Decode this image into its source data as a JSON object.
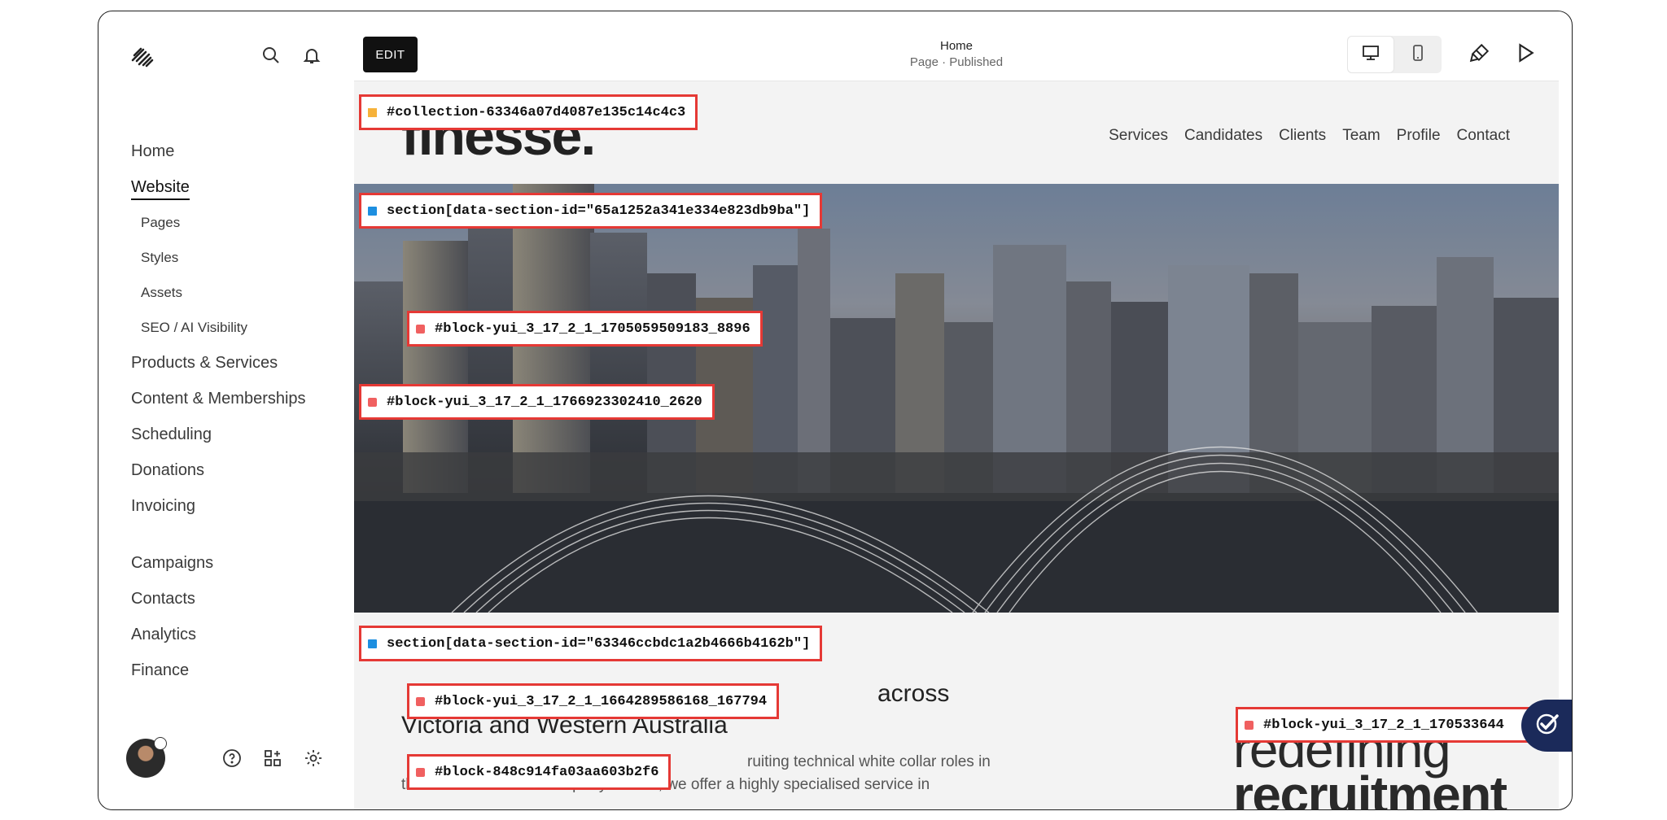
{
  "sidebar": {
    "nav": [
      {
        "label": "Home"
      },
      {
        "label": "Website",
        "active": true
      },
      {
        "label": "Pages",
        "sub": true
      },
      {
        "label": "Styles",
        "sub": true
      },
      {
        "label": "Assets",
        "sub": true
      },
      {
        "label": "SEO / AI Visibility",
        "sub": true
      },
      {
        "label": "Products & Services"
      },
      {
        "label": "Content & Memberships"
      },
      {
        "label": "Scheduling"
      },
      {
        "label": "Donations"
      },
      {
        "label": "Invoicing"
      },
      {
        "label": "Campaigns"
      },
      {
        "label": "Contacts"
      },
      {
        "label": "Analytics"
      },
      {
        "label": "Finance"
      }
    ],
    "icons": {
      "logo": "squarespace-logo-icon",
      "search": "search-icon",
      "notifications": "bell-icon",
      "help": "help-icon",
      "apps": "apps-icon",
      "settings": "gear-icon"
    }
  },
  "editor": {
    "edit_label": "EDIT",
    "page_title": "Home",
    "page_status": "Page · Published",
    "icons": {
      "desktop": "desktop-icon",
      "mobile": "mobile-icon",
      "design": "paintbrush-icon",
      "preview": "play-icon"
    }
  },
  "site": {
    "logo": "finesse.",
    "nav": [
      "Services",
      "Candidates",
      "Clients",
      "Team",
      "Profile",
      "Contact"
    ],
    "heading_line1": "across",
    "heading_line2": "Victoria and Western Australia",
    "body_line1": "ruiting technical white collar roles in",
    "body_line2": "the Construction and Property Market, we offer a highly specialised service in",
    "tagline_line1": "redefining",
    "tagline_line2": "recruitment"
  },
  "selectors": {
    "collection": "#collection-63346a07d4087e135c14c4c3",
    "section_hero": "section[data-section-id=\"65a1252a341e334e823db9ba\"]",
    "block_1": "#block-yui_3_17_2_1_1705059509183_8896",
    "block_2": "#block-yui_3_17_2_1_1766923302410_2620",
    "section_content": "section[data-section-id=\"63346ccbdc1a2b4666b4162b\"]",
    "block_3": "#block-yui_3_17_2_1_1664289586168_167794",
    "block_4": "#block-848c914fa03aa603b2f6",
    "block_5": "#block-yui_3_17_2_1_170533644"
  },
  "colors": {
    "accent": "#e53935",
    "editor_dark": "#111111",
    "badge": "#1b2a5a"
  }
}
